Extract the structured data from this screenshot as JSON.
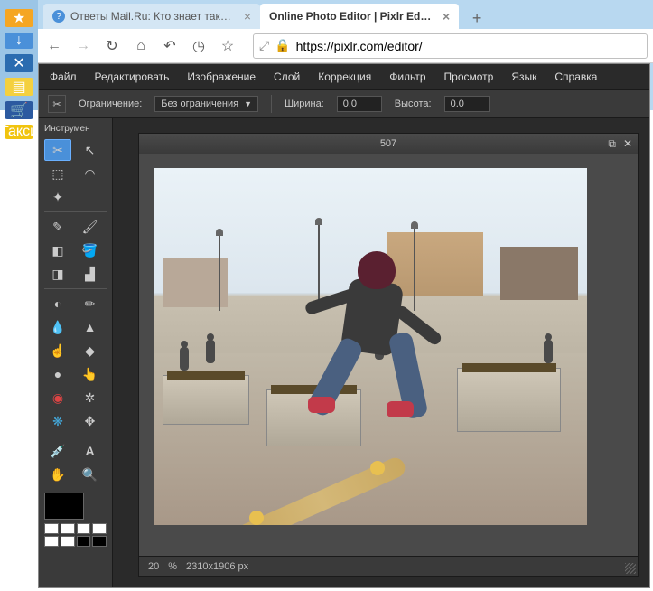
{
  "browser": {
    "tabs": [
      {
        "label": "Ответы Mail.Ru: Кто знает таку...",
        "active": false
      },
      {
        "label": "Online Photo Editor | Pixlr Editor | ...",
        "active": true
      }
    ],
    "url": "https://pixlr.com/editor/"
  },
  "sidebar_tiles": {
    "star": "★",
    "down": "↓",
    "tools": "✕",
    "notes": "▤",
    "cart": "🛒",
    "taxi": "Такси"
  },
  "menu": {
    "file": "Файл",
    "edit": "Редактировать",
    "image": "Изображение",
    "layer": "Слой",
    "adjustment": "Коррекция",
    "filter": "Фильтр",
    "view": "Просмотр",
    "language": "Язык",
    "help": "Справка"
  },
  "option_bar": {
    "constraint_label": "Ограничение:",
    "constraint_value": "Без ограничения",
    "width_label": "Ширина:",
    "width_value": "0.0",
    "height_label": "Высота:",
    "height_value": "0.0"
  },
  "tools_panel": {
    "header": "Инструмен"
  },
  "canvas": {
    "title": "507",
    "zoom": "20",
    "zoom_unit": "%",
    "dimensions": "2310x1906 px"
  }
}
